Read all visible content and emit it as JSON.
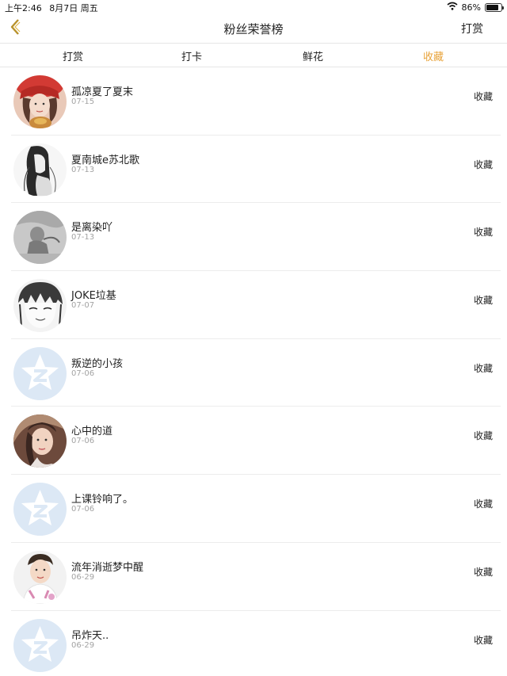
{
  "status": {
    "time": "上午2:46",
    "date": "8月7日 周五",
    "battery": "86%",
    "battery_level": 0.86
  },
  "nav": {
    "title": "粉丝荣誉榜",
    "right_action": "打赏",
    "back_icon": "chevron-left-icon",
    "accent_color": "#e8a33a"
  },
  "tabs": [
    {
      "label": "打赏",
      "active": false
    },
    {
      "label": "打卡",
      "active": false
    },
    {
      "label": "鲜花",
      "active": false
    },
    {
      "label": "收藏",
      "active": true
    }
  ],
  "fans": [
    {
      "name": "孤凉夏了夏末",
      "date": "07-15",
      "action": "收藏",
      "avatar": "photo-girl-red-hat"
    },
    {
      "name": "夏南城e苏北歌",
      "date": "07-13",
      "action": "收藏",
      "avatar": "sketch-girl-long-hair"
    },
    {
      "name": "是离染吖",
      "date": "07-13",
      "action": "收藏",
      "avatar": "grey-photo"
    },
    {
      "name": "JOKE垃基",
      "date": "07-07",
      "action": "收藏",
      "avatar": "anime-boy"
    },
    {
      "name": "叛逆的小孩",
      "date": "07-06",
      "action": "收藏",
      "avatar": "default-qq"
    },
    {
      "name": "心中的道",
      "date": "07-06",
      "action": "收藏",
      "avatar": "photo-girl"
    },
    {
      "name": "上课铃响了。",
      "date": "07-06",
      "action": "收藏",
      "avatar": "default-qq"
    },
    {
      "name": "流年消逝梦中醒",
      "date": "06-29",
      "action": "收藏",
      "avatar": "photo-boy"
    },
    {
      "name": "吊炸天..",
      "date": "06-29",
      "action": "收藏",
      "avatar": "default-qq"
    }
  ]
}
